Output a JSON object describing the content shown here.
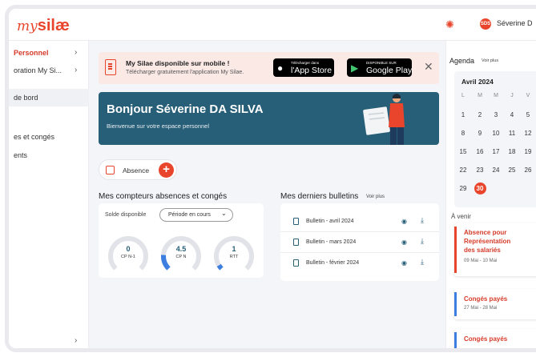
{
  "app": {
    "logo_my": "my",
    "logo_silae": "silæ",
    "user_initials": "SDS",
    "user_name": "Séverine D"
  },
  "sidebar": {
    "items": [
      {
        "label": "Personnel",
        "chevron": "›"
      },
      {
        "label": "oration My Si...",
        "chevron": "›"
      },
      {
        "label": "de bord"
      },
      {
        "label": "es et congés"
      },
      {
        "label": "ents"
      }
    ],
    "bottom_chevron": "›"
  },
  "promo": {
    "title": "My Silae disponible sur mobile !",
    "subtitle": "Télécharger gratuitement l'application My Silae.",
    "apple_small": "Télécharger dans",
    "apple_big": "l'App Store",
    "google_small": "DISPONIBLE SUR",
    "google_big": "Google Play",
    "close": "✕"
  },
  "banner": {
    "greeting": "Bonjour Séverine DA SILVA",
    "subtitle": "Bienvenue sur votre espace personnel"
  },
  "absence": {
    "label": "Absence",
    "plus": "+"
  },
  "counters": {
    "title": "Mes compteurs absences et congés",
    "solde_label": "Solde disponible",
    "period": "Période en cours",
    "period_chevron": "⌄",
    "gauges": [
      {
        "value": "0",
        "label": "CP N-1",
        "fill": 0
      },
      {
        "value": "4.5",
        "label": "CP N",
        "fill": 0.18
      },
      {
        "value": "1",
        "label": "RTT",
        "fill": 0.05
      }
    ],
    "accent": "#285f78",
    "progress_color": "#3d7fe0"
  },
  "bulletins": {
    "title": "Mes derniers bulletins",
    "voir_plus": "Voir plus",
    "items": [
      {
        "label": "Bulletin - avril 2024"
      },
      {
        "label": "Bulletin - mars 2024"
      },
      {
        "label": "Bulletin - février 2024"
      }
    ],
    "eye_icon": "👁",
    "download_icon": "⤓"
  },
  "agenda": {
    "title": "Agenda",
    "voir_plus": "Voir plus",
    "month": "Avril 2024",
    "weekdays": [
      "L",
      "M",
      "M",
      "J",
      "V"
    ],
    "weeks": [
      [
        "1",
        "2",
        "3",
        "4",
        "5"
      ],
      [
        "8",
        "9",
        "10",
        "11",
        "12"
      ],
      [
        "15",
        "16",
        "17",
        "18",
        "19"
      ],
      [
        "22",
        "23",
        "24",
        "25",
        "26"
      ],
      [
        "29",
        "30",
        "",
        "",
        ""
      ]
    ],
    "today": "30",
    "upcoming_label": "À venir",
    "events": [
      {
        "title_lines": [
          "Absence pour",
          "Représentation",
          "des salariés"
        ],
        "dates": "09 Mai - 10 Mai",
        "color": "#e8452c"
      },
      {
        "title_lines": [
          "Congés payés"
        ],
        "dates": "27 Mai - 28 Mai",
        "color": "#3d7fe0"
      },
      {
        "title_lines": [
          "Congés payés"
        ],
        "dates": "",
        "color": "#3d7fe0"
      }
    ]
  },
  "colors": {
    "brand": "#e8452c",
    "banner": "#285f78",
    "background": "#f4f5f8"
  }
}
